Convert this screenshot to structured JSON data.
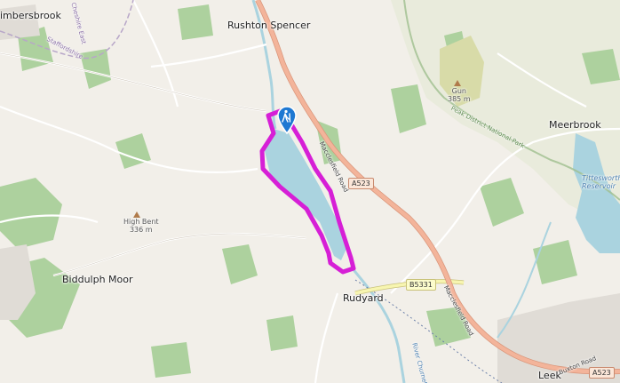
{
  "map": {
    "places": {
      "rushton_spencer": "Rushton Spencer",
      "timbersbrook": "imbersbrook",
      "biddulph_moor": "Biddulph Moor",
      "rudyard": "Rudyard",
      "meerbrook": "Meerbrook",
      "leek": "Leek"
    },
    "peaks": {
      "gun_name": "Gun",
      "gun_height": "385 m",
      "high_bent_name": "High Bent",
      "high_bent_height": "336 m"
    },
    "roads": {
      "a523_north": "A523",
      "b5331": "B5331",
      "a523_south": "A523",
      "macclesfield_road_north": "Macclesfield Road",
      "macclesfield_road_south": "Macclesfield Road",
      "buxton_road": "Buxton Road",
      "staffordshire": "Staffordshire",
      "cheshire_east": "Cheshire East",
      "peak_district_np": "Peak District National Park",
      "river_churnet": "River Churnet"
    },
    "water": {
      "tittesworth_line1": "Tittesworth",
      "tittesworth_line2": "Reservoir"
    },
    "markers": {
      "route_icon": "hiking-icon",
      "route_color": "#d61fd6",
      "marker_color": "#1e78d2"
    },
    "colors": {
      "background": "#f2efe9",
      "woodland": "#add19e",
      "park": "#c8e0a8",
      "water": "#aad3df",
      "primary_road": "#f3b49a",
      "secondary_road": "#f7f5b0",
      "route": "#d61fd6"
    }
  }
}
